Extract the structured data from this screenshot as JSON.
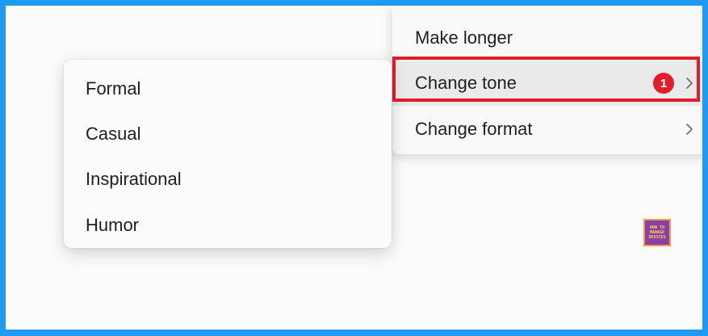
{
  "menu": {
    "items": [
      {
        "label": "Make longer"
      },
      {
        "label": "Change tone",
        "badge": "1"
      },
      {
        "label": "Change format"
      }
    ]
  },
  "submenu": {
    "items": [
      {
        "label": "Formal"
      },
      {
        "label": "Casual"
      },
      {
        "label": "Inspirational"
      },
      {
        "label": "Humor"
      }
    ]
  },
  "watermark": {
    "line1": "HOW TO",
    "line2": "MANAGE",
    "line3": "DEVICES"
  },
  "colors": {
    "frame": "#1e9bf0",
    "highlight": "#e01e29",
    "badge": "#e01e29"
  }
}
